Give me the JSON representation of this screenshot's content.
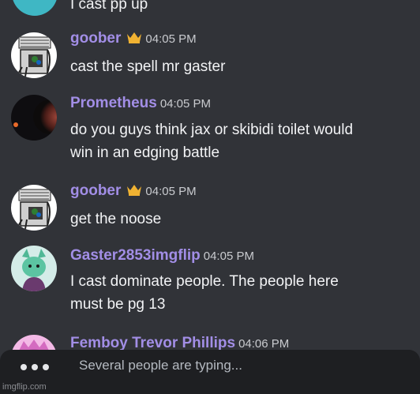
{
  "top_message": {
    "text": "I cast pp up"
  },
  "messages": [
    {
      "username": "goober",
      "has_crown": true,
      "time": "04:05 PM",
      "lines": [
        "cast the spell mr gaster"
      ],
      "avatar": "goober-avatar"
    },
    {
      "username": "Prometheus",
      "has_crown": false,
      "time": "04:05 PM",
      "lines": [
        "do you guys think jax or skibidi toilet would",
        "win in an edging battle"
      ],
      "avatar": "prometheus-avatar"
    },
    {
      "username": "goober",
      "has_crown": true,
      "time": "04:05 PM",
      "lines": [
        "get the noose"
      ],
      "avatar": "goober-avatar"
    },
    {
      "username": "Gaster2853imgflip",
      "has_crown": false,
      "time": "04:05 PM",
      "lines": [
        "I cast dominate people. The people here",
        "must be pg 13"
      ],
      "avatar": "gaster-avatar"
    },
    {
      "username": "Femboy Trevor Phillips",
      "has_crown": false,
      "time": "04:06 PM",
      "lines": [],
      "avatar": "femboy-avatar"
    }
  ],
  "typing_indicator": {
    "text": "Several people are typing..."
  },
  "watermark": {
    "text": "imgflip.com"
  },
  "colors": {
    "background": "#313338",
    "username": "#a28ee6",
    "crown": "#f0b232",
    "text": "#f2f3f5",
    "timestamp": "#c9cbcf",
    "typing_bar": "#1e1f22"
  }
}
